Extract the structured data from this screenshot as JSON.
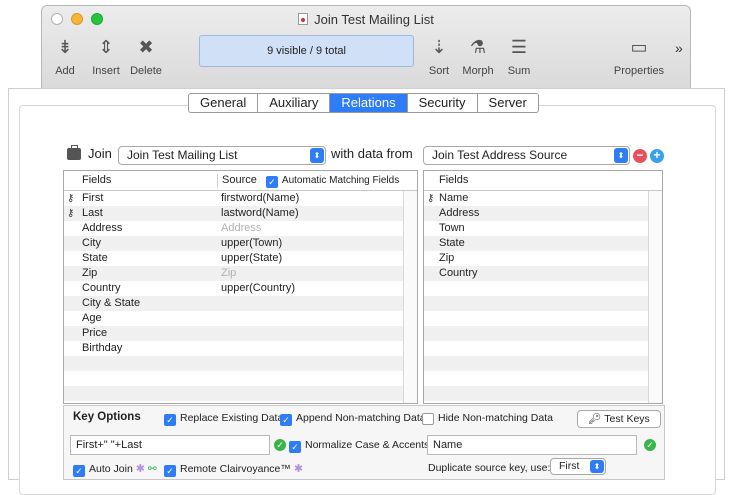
{
  "window": {
    "title": "Join Test Mailing List"
  },
  "toolbar": {
    "add": "Add",
    "insert": "Insert",
    "delete": "Delete",
    "status": "9 visible / 9 total",
    "sort": "Sort",
    "morph": "Morph",
    "sum": "Sum",
    "properties": "Properties",
    "more": "»"
  },
  "tabs": [
    "General",
    "Auxiliary",
    "Relations",
    "Security",
    "Server"
  ],
  "join": {
    "label": "Join",
    "database": "Join Test Mailing List",
    "with_label": "with data from",
    "source": "Join Test Address Source"
  },
  "left_table": {
    "col_fields": "Fields",
    "col_source": "Source",
    "auto_match": "Automatic Matching Fields",
    "rows": [
      {
        "field": "First",
        "source": "firstword(Name)",
        "key": true,
        "dim": false
      },
      {
        "field": "Last",
        "source": "lastword(Name)",
        "key": true,
        "dim": false
      },
      {
        "field": "Address",
        "source": "Address",
        "key": false,
        "dim": true
      },
      {
        "field": "City",
        "source": "upper(Town)",
        "key": false,
        "dim": false
      },
      {
        "field": "State",
        "source": "upper(State)",
        "key": false,
        "dim": false
      },
      {
        "field": "Zip",
        "source": "Zip",
        "key": false,
        "dim": true
      },
      {
        "field": "Country",
        "source": "upper(Country)",
        "key": false,
        "dim": false
      },
      {
        "field": "City & State",
        "source": "",
        "key": false,
        "dim": false
      },
      {
        "field": "Age",
        "source": "",
        "key": false,
        "dim": false
      },
      {
        "field": "Price",
        "source": "",
        "key": false,
        "dim": false
      },
      {
        "field": "Birthday",
        "source": "",
        "key": false,
        "dim": false
      },
      {
        "field": "",
        "source": "",
        "key": false,
        "dim": false
      },
      {
        "field": "",
        "source": "",
        "key": false,
        "dim": false
      },
      {
        "field": "",
        "source": "",
        "key": false,
        "dim": false
      }
    ]
  },
  "right_table": {
    "col_fields": "Fields",
    "rows": [
      {
        "field": "Name",
        "key": true
      },
      {
        "field": "Address",
        "key": false
      },
      {
        "field": "Town",
        "key": false
      },
      {
        "field": "State",
        "key": false
      },
      {
        "field": "Zip",
        "key": false
      },
      {
        "field": "Country",
        "key": false
      },
      {
        "field": "",
        "key": false
      },
      {
        "field": "",
        "key": false
      },
      {
        "field": "",
        "key": false
      },
      {
        "field": "",
        "key": false
      },
      {
        "field": "",
        "key": false
      },
      {
        "field": "",
        "key": false
      },
      {
        "field": "",
        "key": false
      },
      {
        "field": "",
        "key": false
      }
    ]
  },
  "key_options": {
    "title": "Key Options",
    "replace": "Replace Existing Data",
    "append": "Append Non-matching Data",
    "hide": "Hide Non-matching Data",
    "test_keys": "Test Keys",
    "left_formula": "First+\" \"+Last",
    "normalize": "Normalize Case & Accents",
    "right_formula": "Name",
    "auto_join": "Auto Join",
    "remote": "Remote Clairvoyance™",
    "dup_label": "Duplicate source key, use:",
    "dup_value": "First"
  },
  "colors": {
    "accent": "#2e7cf6",
    "minus": "#e8505b",
    "plus": "#3aa0e8",
    "ok": "#39b54a"
  }
}
